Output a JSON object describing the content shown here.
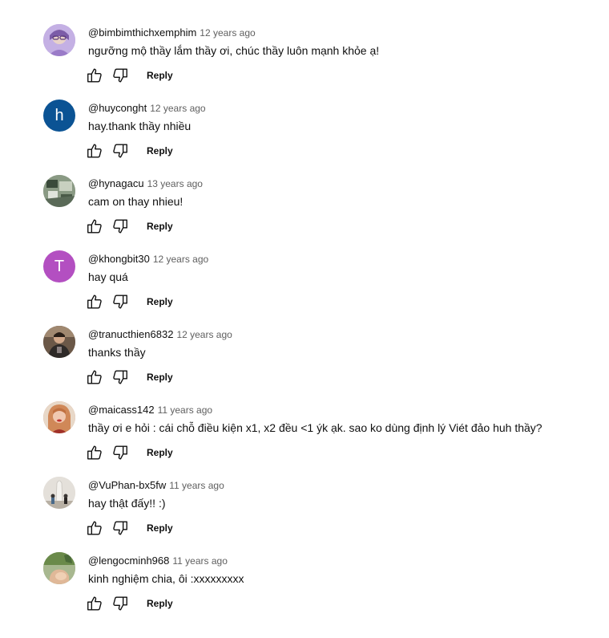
{
  "ui": {
    "reply_label": "Reply"
  },
  "comments": [
    {
      "handle": "@bimbimthichxemphim",
      "time": "12 years ago",
      "text": "ngưỡng mộ thầy lắm thầy ơi, chúc thầy luôn mạnh khỏe ạ!",
      "avatar": {
        "type": "photo",
        "color": "#b49ad8"
      }
    },
    {
      "handle": "@huyconght",
      "time": "12 years ago",
      "text": "hay.thank thầy nhiều",
      "avatar": {
        "type": "letter",
        "letter": "h",
        "color": "#0b5394"
      }
    },
    {
      "handle": "@hynagacu",
      "time": "13 years ago",
      "text": "cam on thay nhieu!",
      "avatar": {
        "type": "photo",
        "color": "#7a8a72"
      }
    },
    {
      "handle": "@khongbit30",
      "time": "12 years ago",
      "text": "hay quá",
      "avatar": {
        "type": "letter",
        "letter": "T",
        "color": "#b34fc1"
      }
    },
    {
      "handle": "@tranucthien6832",
      "time": "12 years ago",
      "text": "thanks thầy",
      "avatar": {
        "type": "photo",
        "color": "#5d4a3c"
      }
    },
    {
      "handle": "@maicass142",
      "time": "11 years ago",
      "text": "thầy ơi e hỏi : cái chỗ điều kiện x1, x2 đều <1 ýk ạk. sao ko dùng định lý Viét đảo huh thầy?",
      "avatar": {
        "type": "photo",
        "color": "#c9866a"
      }
    },
    {
      "handle": "@VuPhan-bx5fw",
      "time": "11 years ago",
      "text": "hay thật đấy!! :)",
      "avatar": {
        "type": "photo",
        "color": "#d6d2cc"
      }
    },
    {
      "handle": "@lengocminh968",
      "time": "11 years ago",
      "text": "kinh nghiệm chia, ôi :xxxxxxxxx",
      "avatar": {
        "type": "photo",
        "color": "#8fa66b"
      }
    }
  ]
}
